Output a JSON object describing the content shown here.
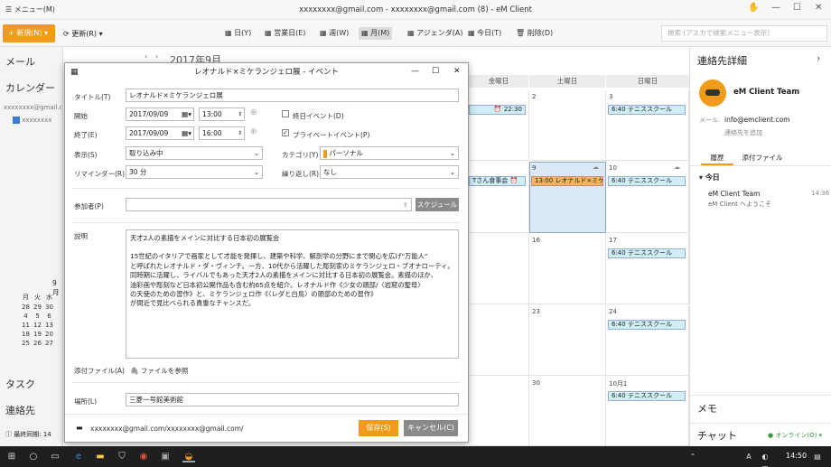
{
  "window": {
    "menu_label": "メニュー(M)",
    "title": "xxxxxxxx@gmail.com - xxxxxxxx@gmail.com (8) - eM Client",
    "controls": [
      "✋",
      "—",
      "☐",
      "✕"
    ]
  },
  "toolbar": {
    "new_label": "+ 新規(N) ▾",
    "update_label": "更新(R) ▾",
    "views": [
      "日(Y)",
      "営業日(E)",
      "週(W)",
      "月(M)",
      "アジェンダ(A)",
      "今日(T)",
      "削除(D)"
    ],
    "search_placeholder": "検索 (アスカで検索メニュー表示)"
  },
  "left": {
    "mail": "メール",
    "calendar": "カレンダー",
    "account": "xxxxxxxx@gmail.com",
    "subcal": "xxxxxxxx",
    "mini_month": "9月",
    "mini_days": [
      "月",
      "火",
      "水"
    ],
    "mini_rows": [
      [
        "28",
        "29",
        "30"
      ],
      [
        "4",
        "5",
        "6"
      ],
      [
        "11",
        "12",
        "13"
      ],
      [
        "18",
        "19",
        "20"
      ],
      [
        "25",
        "26",
        "27"
      ]
    ],
    "tasks": "タスク",
    "contacts": "連絡先",
    "footer": "最終同期: 14"
  },
  "calendar": {
    "month_title": "2017年9月",
    "day_headers": [
      "金曜日",
      "土曜日",
      "日曜日"
    ],
    "cells": {
      "fri_r1_event": "22:30",
      "sat_r1": "2",
      "sun_r1": "3",
      "sun_r1_event": "6:40  テニススクール",
      "fri_r2_event": "Tさん食事会",
      "sat_r2": "9",
      "sat_r2_event": "13:00  レオナルド×ミケ...",
      "sun_r2": "10",
      "sun_r2_event": "6:40  テニススクール",
      "sat_r3": "16",
      "sun_r3": "17",
      "sun_r3_event": "6:40  テニススクール",
      "sat_r4": "23",
      "sun_r4": "24",
      "sun_r4_event": "6:40  テニススクール",
      "sat_r5": "30",
      "sun_r5": "10月1",
      "sun_r5_event": "6:40  テニススクール"
    }
  },
  "dialog": {
    "title": "レオナルド×ミケランジェロ展 - イベント",
    "title_label": "タイトル(T)",
    "title_value": "レオナルド×ミケランジェロ展",
    "start_label": "開始",
    "start_date": "2017/09/09",
    "start_time": "13:00",
    "allday_label": "終日イベント(D)",
    "end_label": "終了(E)",
    "end_date": "2017/09/09",
    "end_time": "16:00",
    "private_label": "プライベートイベント(P)",
    "show_label": "表示(S)",
    "show_value": "取り込み中",
    "category_label": "カテゴリ(Y)",
    "category_value": "パーソナル",
    "reminder_label": "リマインダー(R)",
    "reminder_value": "30 分",
    "repeat_label": "繰り返し(R)",
    "repeat_value": "なし",
    "attendee_label": "参加者(P)",
    "schedule_btn": "スケジュール",
    "desc_label": "説明",
    "desc_lines": [
      "天才2人の素描をメインに対比する日本初の展覧会",
      "",
      "15世紀のイタリアで画家として才能を発揮し、建築や科学、解剖学の分野にまで関心を広げ\"万能人\"",
      "と呼ばれたレオナルド・ダ・ヴィンチ。一方、10代から活躍した彫刻家のミケランジェロ・ブオナローティ。",
      "同時期に活躍し、ライバルでもあった天才2人の素描をメインに対比する日本初の展覧会。素描のほか、",
      "油彩画や彫刻など日本初公開作品も含む約65点を紹介。レオナルド作《少女の頭部/〈岩窟の聖母〉",
      "の天使のための習作》と、ミケランジェロ作《〈レダと白鳥〉の頭部のための習作》",
      "が間近で見比べられる貴重なチャンスだ。"
    ],
    "attach_label": "添付ファイル(A)",
    "attach_ref": "ファイルを参照",
    "location_label": "場所(L)",
    "location_value": "三菱一号館美術館",
    "footer_account": "xxxxxxxx@gmail.com/xxxxxxxx@gmail.com/",
    "save": "保存(S)",
    "cancel": "キャンセル(C)"
  },
  "right": {
    "title": "連絡先詳細",
    "name": "eM Client Team",
    "mail_label": "メール:",
    "mail_value": "info@emclient.com",
    "add_link": "連絡先を追加",
    "tab_history": "履歴",
    "tab_attach": "添付ファイル",
    "today": "今日",
    "item_name": "eM Client Team",
    "item_time": "14:36",
    "item_sub": "eM Client へようこそ",
    "memo": "メモ",
    "chat": "チャット",
    "online": "● オンライン(O) ▾"
  },
  "taskbar": {
    "time": "14:50",
    "ime": "A"
  }
}
